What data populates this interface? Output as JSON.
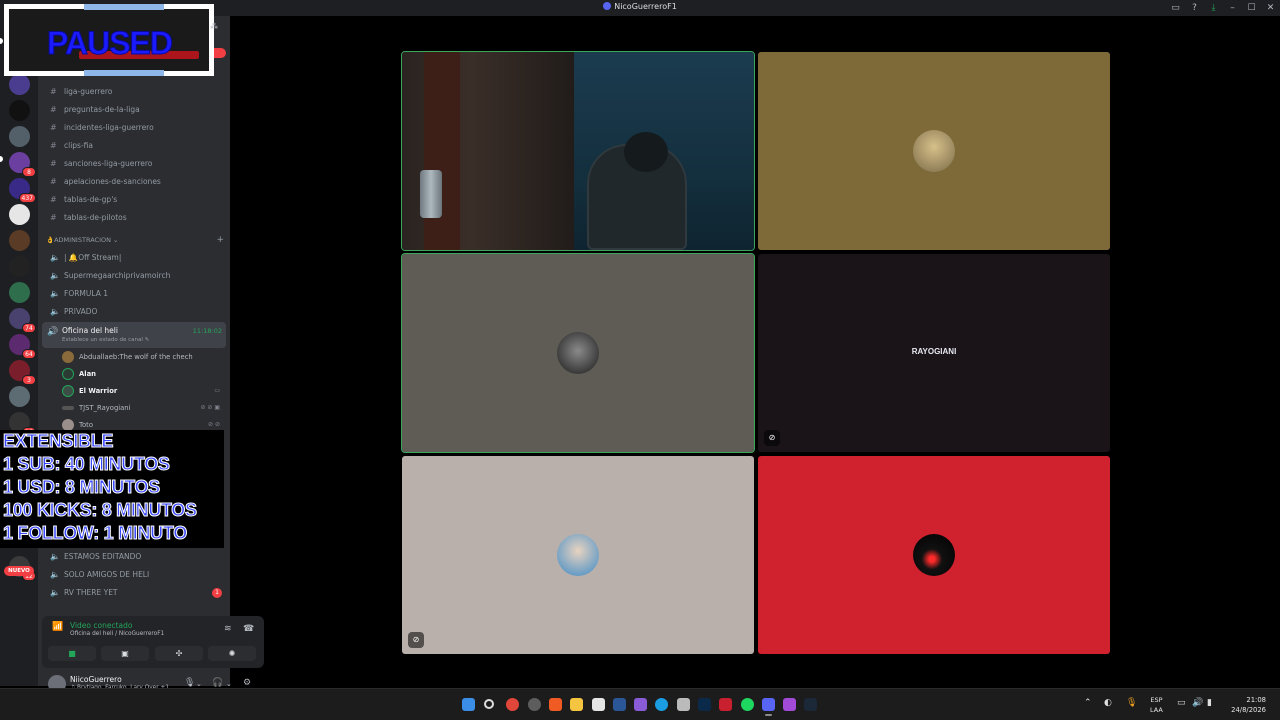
{
  "window": {
    "title": "NicoGuerreroF1",
    "buttons": {
      "inbox": "▭",
      "help": "?",
      "download": "⤓",
      "minimize": "–",
      "maximize": "☐",
      "close": "✕"
    }
  },
  "server_rail": {
    "badges": [
      "19",
      "1",
      "8",
      "437",
      "74",
      "64",
      "3",
      "16",
      "12"
    ],
    "new_label": "NUEVO",
    "last_badge": "1"
  },
  "paused_box": {
    "label": "PAUSED"
  },
  "channels": {
    "text_channels": [
      "liga-guerrero",
      "preguntas-de-la-liga",
      "incidentes-liga-guerrero",
      "clips-fia",
      "sanciones-liga-guerrero",
      "apelaciones-de-sanciones",
      "tablas-de-gp's",
      "tablas-de-pilotos"
    ],
    "category": "👌ADMINISTRACION",
    "voice_channels": [
      "| 🔔Off Stream|",
      "Supermegaarchiprivamoirch",
      "FORMULA 1",
      "PRIVADO"
    ],
    "active_voice": {
      "name": "Oficina del heli",
      "status": "Establece un estado de canal ✎",
      "timer": "11:18:02"
    },
    "members": [
      {
        "name": "Abduallaeb:The wolf of the chech",
        "bold": false,
        "icons": ""
      },
      {
        "name": "Alan",
        "bold": true,
        "icons": ""
      },
      {
        "name": "El Warrior",
        "bold": true,
        "icons": "▭"
      },
      {
        "name": "TJST_Rayogiani",
        "bold": false,
        "icons": "⊘ ⊘ ▣"
      },
      {
        "name": "Toto",
        "bold": false,
        "icons": "⊘ ⊘"
      }
    ],
    "lower_voice_channels": [
      "ESTAMOS EDITANDO",
      "SOLO AMIGOS DE HELI",
      "RV THERE YET"
    ]
  },
  "overlay": {
    "lines": [
      "EXTENSIBLE",
      "1 SUB: 40 MINUTOS",
      "1 USD: 8 MINUTOS",
      "100 KICKS: 8 MINUTOS",
      "1 FOLLOW: 1 MINUTO"
    ]
  },
  "voice_panel": {
    "status": "Video conectado",
    "location": "Oficina del heli / NicoGuerreroF1"
  },
  "user_panel": {
    "username": "NiicoGuerrero",
    "activity": "♫ Brytiago, Farruko, Lary Over +1"
  },
  "tiles": [
    {
      "id": "camera",
      "label": ""
    },
    {
      "id": "olive",
      "label": ""
    },
    {
      "id": "grey",
      "label": ""
    },
    {
      "id": "rayogiani",
      "label": "RAYOGIANI"
    },
    {
      "id": "pink",
      "label": ""
    },
    {
      "id": "red",
      "label": ""
    }
  ],
  "colors": {
    "tile_olive": "#7d6a38",
    "tile_grey": "#5f5c55",
    "tile_dark": "#1a1419",
    "tile_pink": "#b9b0ac",
    "tile_red": "#d0212e",
    "speaking": "#3ba55c"
  },
  "taskbar": {
    "language": [
      "ESP",
      "LAA"
    ],
    "time": "21:08",
    "date": "24/8/2026"
  }
}
